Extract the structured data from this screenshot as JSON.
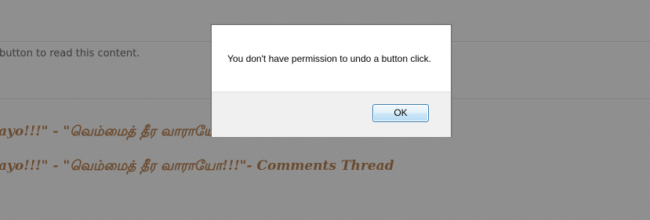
{
  "background": {
    "notice_text": "button to read this content.",
    "thread_titles": [
      "ayo!!!\" - \"வெம்மைத் தீர வாராயோ!!!\"- Comments Thread",
      "ayo!!!\" - \"வெம்மைத் தீர வாராயோ!!!\"- Comments Thread"
    ]
  },
  "dialog": {
    "message": "You don't have permission to undo a button click.",
    "ok_label": "OK"
  },
  "colors": {
    "overlay": "#8e8e8e",
    "title_text": "#6a4a2e",
    "button_border": "#3c7fb1"
  }
}
